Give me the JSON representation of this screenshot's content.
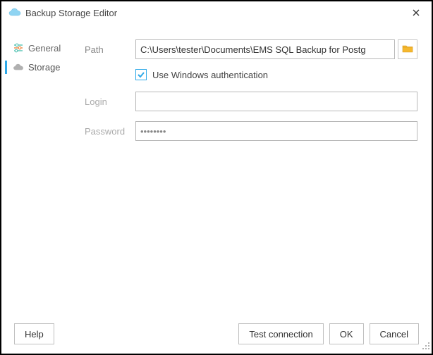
{
  "window": {
    "title": "Backup Storage Editor"
  },
  "sidebar": {
    "items": [
      {
        "label": "General"
      },
      {
        "label": "Storage"
      }
    ]
  },
  "form": {
    "path_label": "Path",
    "path_value": "C:\\Users\\tester\\Documents\\EMS SQL Backup for Postg",
    "use_windows_auth_label": "Use Windows authentication",
    "use_windows_auth_checked": true,
    "login_label": "Login",
    "login_value": "",
    "password_label": "Password",
    "password_value": "••••••••"
  },
  "buttons": {
    "help": "Help",
    "test_connection": "Test connection",
    "ok": "OK",
    "cancel": "Cancel"
  }
}
